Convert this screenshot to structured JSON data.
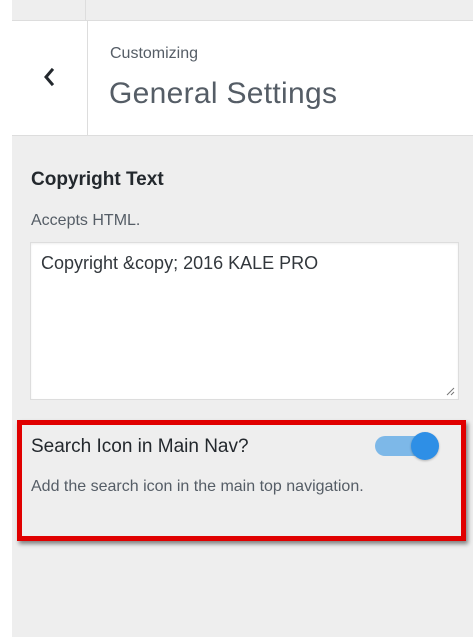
{
  "header": {
    "action": "Customizing",
    "title": "General Settings"
  },
  "copyright": {
    "title": "Copyright Text",
    "description": "Accepts HTML.",
    "value": "Copyright &copy; 2016 KALE PRO"
  },
  "search_icon": {
    "title": "Search Icon in Main Nav?",
    "description": "Add the search icon in the main top navigation.",
    "enabled": true
  },
  "colors": {
    "accent": "#2e8fe6",
    "highlight": "#e00000"
  },
  "icons": {
    "back": "chevron-left-icon",
    "resize": "resize-grip-icon"
  }
}
